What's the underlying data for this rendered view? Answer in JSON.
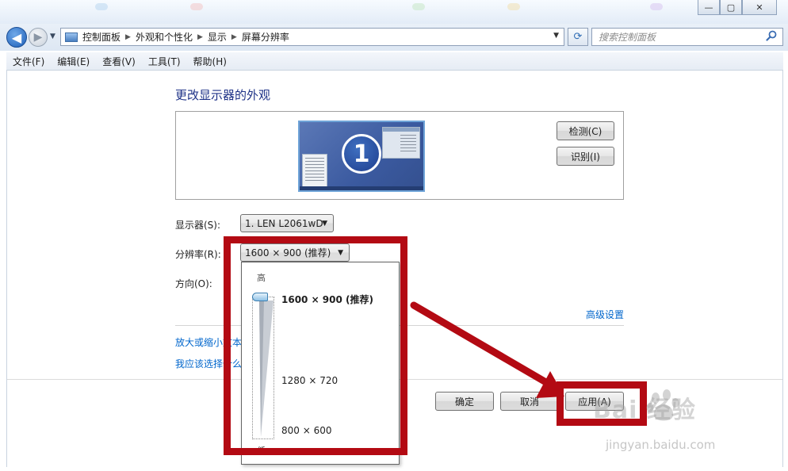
{
  "window": {
    "minimize_glyph": "—",
    "maximize_glyph": "▢",
    "close_glyph": "✕",
    "decoration_colors": [
      "#b9d7f0",
      "#f3c6c6",
      "#c6e8c6",
      "#f0e0b0",
      "#d8c6f0"
    ]
  },
  "navbar": {
    "back_glyph": "◀",
    "forward_glyph": "▶",
    "recent_glyph": "▼",
    "breadcrumb": [
      "控制面板",
      "外观和个性化",
      "显示",
      "屏幕分辨率"
    ],
    "crumb_separator": "▶",
    "address_dropdown_glyph": "▼",
    "refresh_glyph": "⟳",
    "search_placeholder": "搜索控制面板",
    "icons": {
      "back": "back-arrow-icon",
      "forward": "forward-arrow-icon",
      "address": "control-panel-icon",
      "refresh": "refresh-icon",
      "search": "search-icon"
    }
  },
  "menu": [
    "文件(F)",
    "编辑(E)",
    "查看(V)",
    "工具(T)",
    "帮助(H)"
  ],
  "main": {
    "title": "更改显示器的外观",
    "monitor_number": "1",
    "detect_button": "检测(C)",
    "identify_button": "识别(I)",
    "display_label": "显示器(S):",
    "display_value": "1. LEN L2061wD",
    "resolution_label": "分辨率(R):",
    "resolution_value": "1600 × 900 (推荐)",
    "orientation_label": "方向(O):",
    "advanced_link": "高级设置",
    "link_zoom_text": "放大或缩小文本",
    "link_choose": "我应该选择什么",
    "combo_arrow_glyph": "▼"
  },
  "dropdown": {
    "high_label": "高",
    "low_label": "低",
    "options": [
      "1600 × 900 (推荐)",
      "1280 × 720",
      "800 × 600"
    ],
    "selected_level": 1.0
  },
  "footer": {
    "ok_button": "确定",
    "cancel_button": "取消",
    "apply_button": "应用(A)"
  },
  "annotations": {
    "color": "#b30a13"
  },
  "watermark": {
    "logo_text": "Bai  经验",
    "url": "jingyan.baidu.com"
  }
}
